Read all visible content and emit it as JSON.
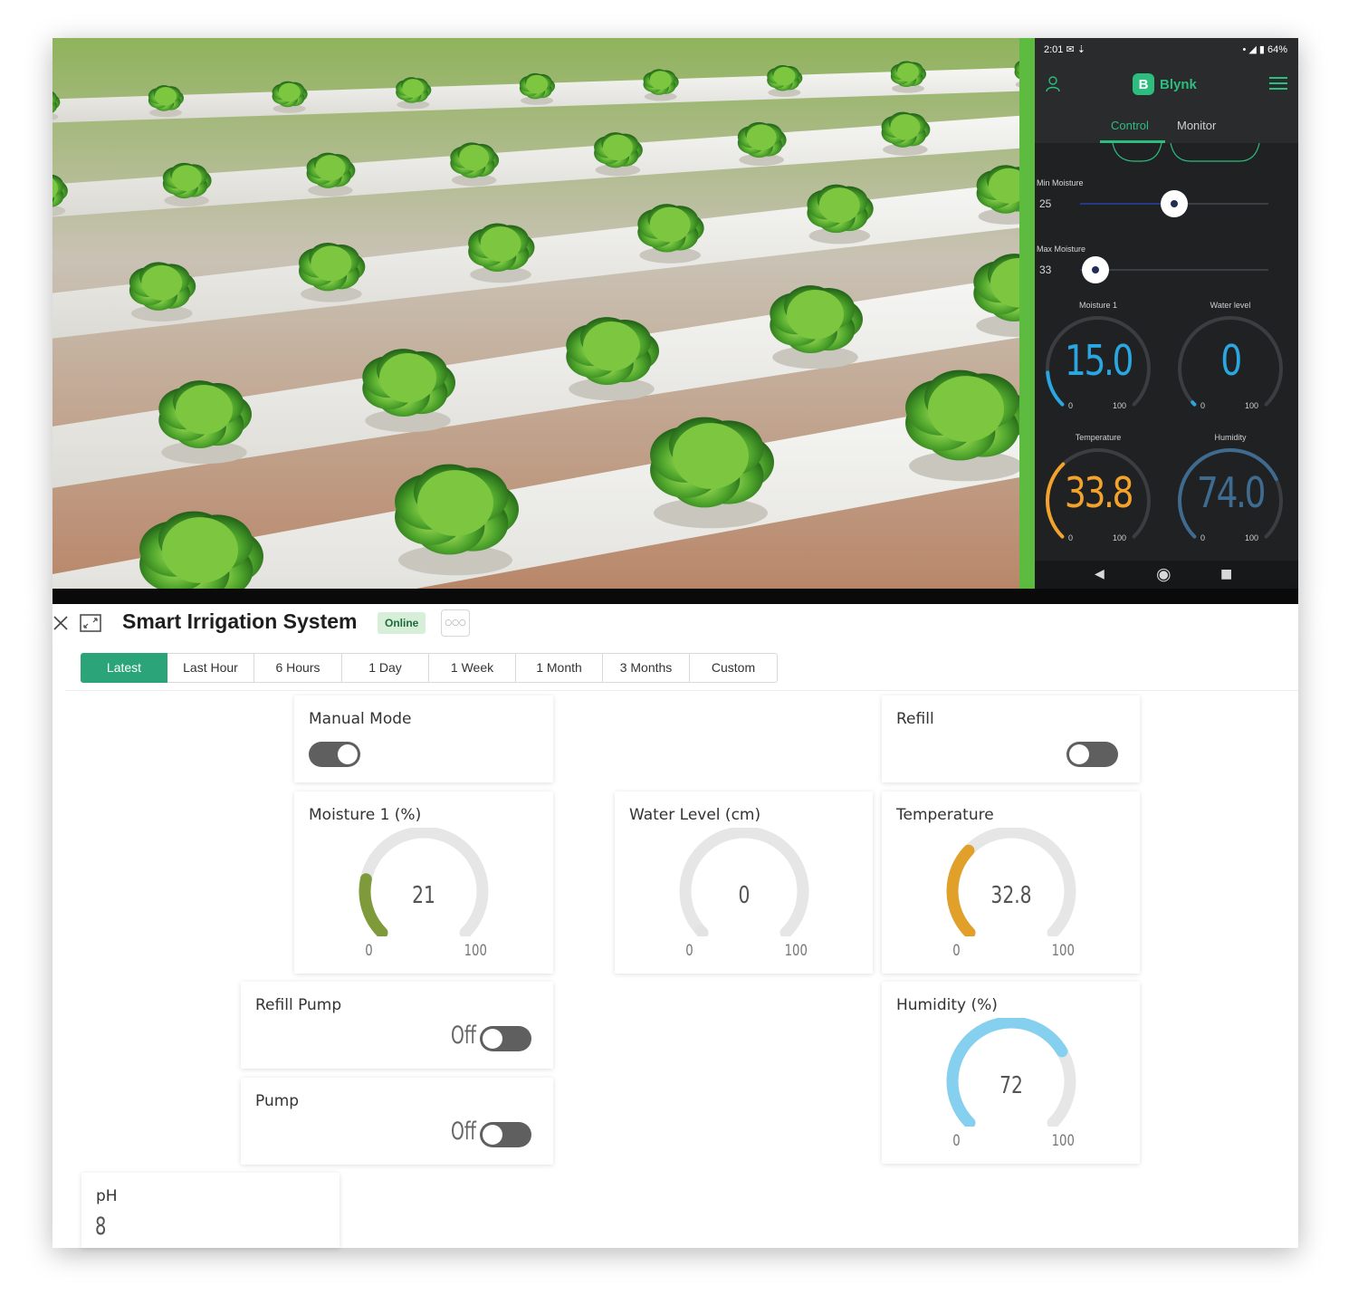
{
  "phone": {
    "status_time": "2:01 ✉ ⇣",
    "status_right": "• ◢ ▮ 64%",
    "brand_letter": "B",
    "brand_name": "Blynk",
    "tabs": [
      {
        "label": "Control",
        "active": true
      },
      {
        "label": "Monitor",
        "active": false
      }
    ],
    "sliders": [
      {
        "label": "Min Moisture",
        "value": "25",
        "fraction": 0.5
      },
      {
        "label": "Max Moisture",
        "value": "33",
        "fraction": 0.08
      }
    ],
    "gauges": [
      {
        "label": "Moisture 1",
        "value": "15.0",
        "min": "0",
        "max": "100",
        "level": 0.15,
        "color": "#2aa7e0"
      },
      {
        "label": "Water level",
        "value": "0",
        "min": "0",
        "max": "100",
        "level": 0.0,
        "color": "#2aa7e0"
      },
      {
        "label": "Temperature",
        "value": "33.8",
        "min": "0",
        "max": "100",
        "level": 0.338,
        "color": "#f3a32b"
      },
      {
        "label": "Humidity",
        "value": "74.0",
        "min": "0",
        "max": "100",
        "level": 0.74,
        "color": "#3e6b8f"
      }
    ]
  },
  "dashboard": {
    "title": "Smart Irrigation System",
    "status": "Online",
    "more": "○○○",
    "time_ranges": [
      {
        "label": "Latest",
        "active": true
      },
      {
        "label": "Last Hour",
        "active": false
      },
      {
        "label": "6 Hours",
        "active": false
      },
      {
        "label": "1 Day",
        "active": false
      },
      {
        "label": "1 Week",
        "active": false
      },
      {
        "label": "1 Month",
        "active": false
      },
      {
        "label": "3 Months",
        "active": false
      },
      {
        "label": "Custom",
        "active": false
      }
    ],
    "manual_mode": {
      "title": "Manual Mode",
      "on": true
    },
    "refill": {
      "title": "Refill",
      "on": false
    },
    "refill_pump": {
      "title": "Refill Pump",
      "state": "Off"
    },
    "pump": {
      "title": "Pump",
      "state": "Off"
    },
    "ph": {
      "title": "pH",
      "value": "8"
    },
    "gauges": {
      "moisture": {
        "title": "Moisture 1 (%)",
        "value": "21",
        "min": "0",
        "max": "100",
        "level": 0.21,
        "color": "#7e9a3a"
      },
      "water": {
        "title": "Water Level (cm)",
        "value": "0",
        "min": "0",
        "max": "100",
        "level": 0.0,
        "color": "#e3e3e3"
      },
      "temperature": {
        "title": "Temperature",
        "value": "32.8",
        "min": "0",
        "max": "100",
        "level": 0.328,
        "color": "#e0a02a"
      },
      "humidity": {
        "title": "Humidity (%)",
        "value": "72",
        "min": "0",
        "max": "100",
        "level": 0.72,
        "color": "#86d0ef"
      }
    },
    "track_color": "#e6e6e6"
  }
}
